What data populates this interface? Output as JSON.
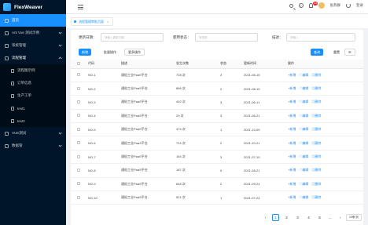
{
  "app": {
    "name": "FlexWeaver"
  },
  "sidebar": {
    "items": [
      {
        "label": "首页"
      },
      {
        "label": "Ant Vue 测试示例"
      },
      {
        "label": "系统管理"
      },
      {
        "label": "流程管理"
      }
    ],
    "subitems": [
      {
        "label": "流程图示例"
      },
      {
        "label": "订单信息"
      },
      {
        "label": "生产工单"
      },
      {
        "label": "test1"
      },
      {
        "label": "test2"
      }
    ],
    "bottom_items": [
      {
        "label": "VUE测试"
      },
      {
        "label": "数据管"
      }
    ]
  },
  "topbar": {
    "notification_count": "14",
    "username": "张燕群",
    "logout": "登录"
  },
  "tabs": [
    {
      "label": "流程管理审批页面"
    }
  ],
  "filters": {
    "date_label": "更新日期：",
    "date_placeholder": "请输入更新日期",
    "status_label": "使用状态：",
    "status_placeholder": "请选择",
    "desc_label": "描述：",
    "desc_placeholder": "请输入"
  },
  "toolbar": {
    "add": "新增",
    "batch": "批量操作",
    "more": "更多操作",
    "search": "查询",
    "reset": "重置"
  },
  "table": {
    "headers": [
      "代码",
      "描述",
      "发生次数",
      "状态",
      "更新时间",
      "操作"
    ],
    "rows": [
      {
        "code": "NO-1",
        "desc": "通俗工业PaaS平台",
        "count": "728 次",
        "status": "3",
        "time": "2021-08-15"
      },
      {
        "code": "NO-2",
        "desc": "通俗工业PaaS平台",
        "count": "866 次",
        "status": "2",
        "time": "2021-08-10"
      },
      {
        "code": "NO-3",
        "desc": "通俗工业PaaS平台",
        "count": "402 次",
        "status": "3",
        "time": "2021-06-11"
      },
      {
        "code": "NO-4",
        "desc": "通俗工业PaaS平台",
        "count": "29 次",
        "status": "3",
        "time": "2021-06-21"
      },
      {
        "code": "NO-5",
        "desc": "通俗工业PaaS平台",
        "count": "474 次",
        "status": "1",
        "time": "2021-10-09"
      },
      {
        "code": "NO-6",
        "desc": "通俗工业PaaS平台",
        "count": "724 次",
        "status": "2",
        "time": "2021-10-21"
      },
      {
        "code": "NO-7",
        "desc": "通俗工业PaaS平台",
        "count": "164 次",
        "status": "3",
        "time": "2021-07-10"
      },
      {
        "code": "NO-8",
        "desc": "通俗工业PaaS平台",
        "count": "187 次",
        "status": "0",
        "time": "2021-08-21"
      },
      {
        "code": "NO-9",
        "desc": "通俗工业PaaS平台",
        "count": "648 次",
        "status": "2",
        "time": "2021-09-24"
      },
      {
        "code": "NO-10",
        "desc": "通俗工业PaaS平台",
        "count": "521 次",
        "status": "1",
        "time": "2021-07-24"
      }
    ],
    "actions": [
      "+新增",
      "◇编辑",
      "◎删除"
    ]
  },
  "pager": {
    "prev": "‹",
    "pages": [
      "1",
      "2",
      "3",
      "4",
      "5",
      "..."
    ],
    "next": "›",
    "size": "10条/页"
  }
}
